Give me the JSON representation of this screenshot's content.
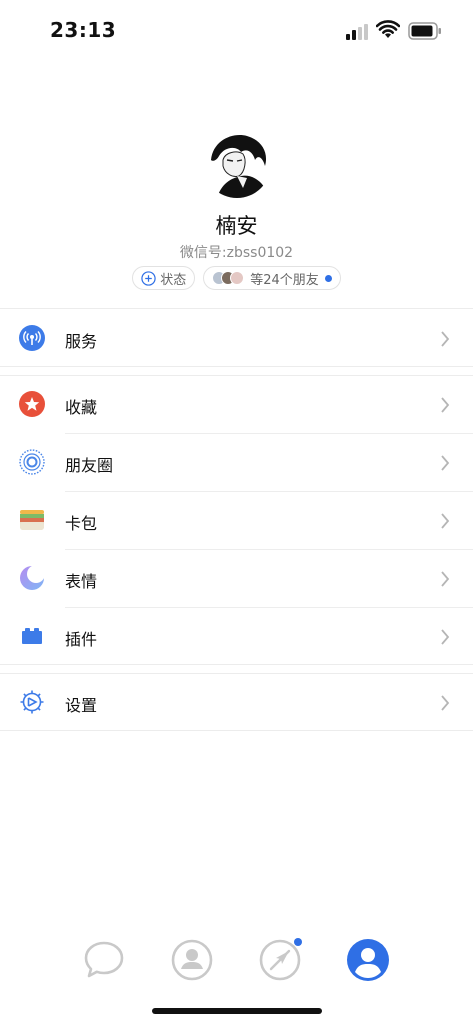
{
  "status_bar": {
    "time": "23:13"
  },
  "profile": {
    "name": "楠安",
    "wechat_id": "微信号:zbss0102",
    "status_chip": "状态",
    "friends_chip": "等24个朋友"
  },
  "menu": {
    "services": "服务",
    "favorites": "收藏",
    "moments": "朋友圈",
    "cards": "卡包",
    "stickers": "表情",
    "plugins": "插件",
    "settings": "设置"
  },
  "colors": {
    "accent": "#2f6fe5",
    "favorites_red": "#e8503a",
    "chevron": "#b5b5b5"
  },
  "icons": {
    "services": "signal-broadcast-icon",
    "favorites": "star-icon",
    "moments": "camera-aperture-icon",
    "cards": "wallet-icon",
    "stickers": "moon-icon",
    "plugins": "puzzle-block-icon",
    "settings": "gear-icon"
  },
  "tab_bar": {
    "chats": "chat-bubble-icon",
    "contacts": "contacts-icon",
    "discover": "compass-icon",
    "me": "me-icon"
  }
}
